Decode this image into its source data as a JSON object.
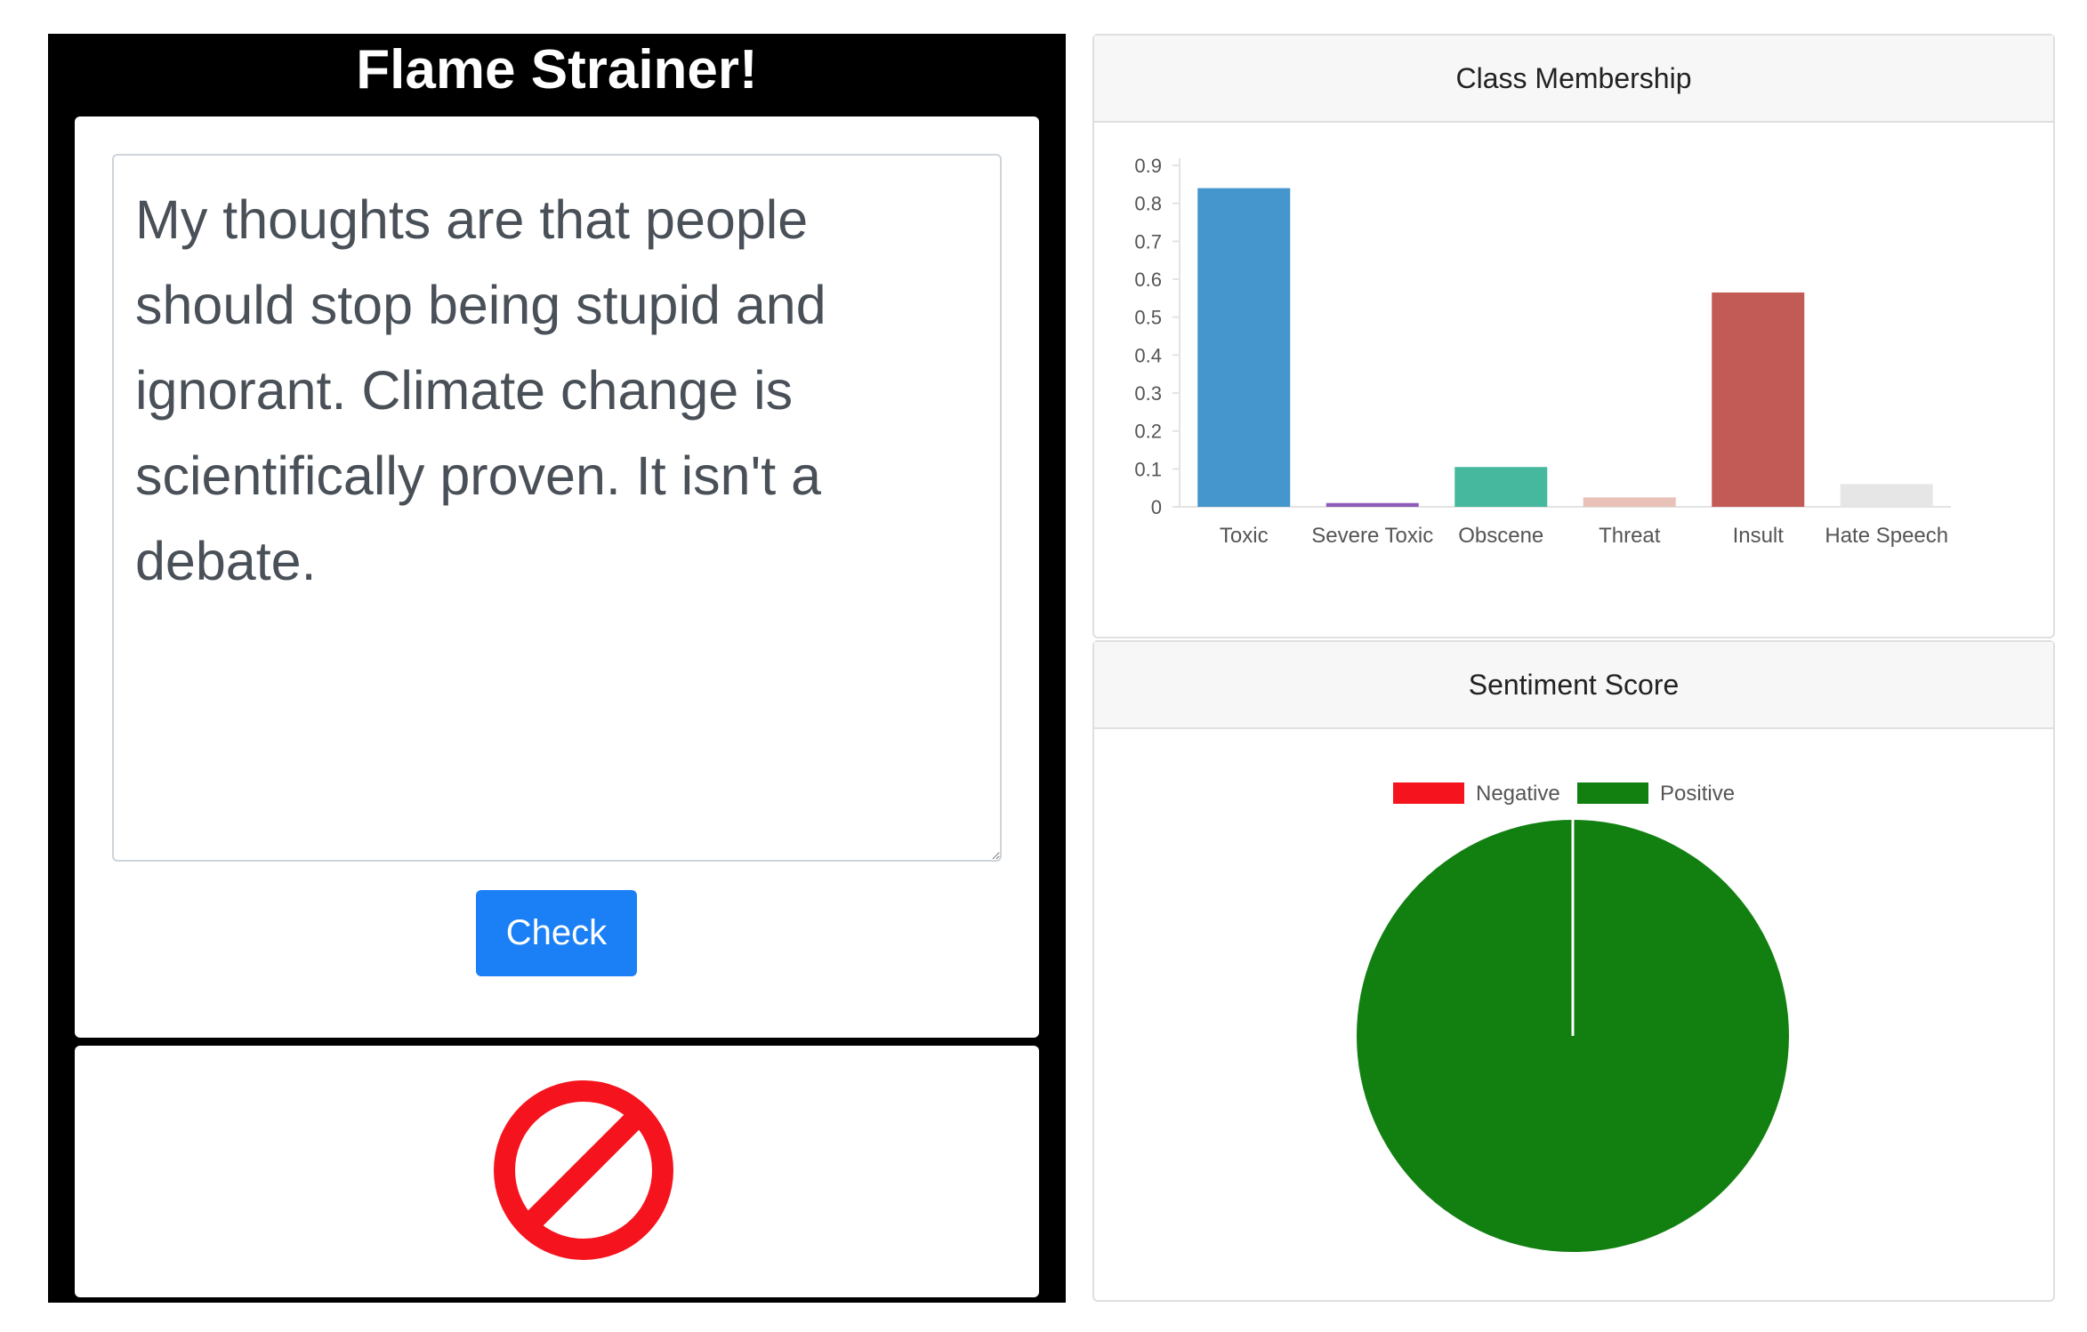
{
  "app": {
    "title": "Flame Strainer!"
  },
  "input": {
    "comment_text": "My thoughts are that people should stop being stupid and ignorant. Climate change is scientifically proven. It isn't a debate.",
    "check_label": "Check"
  },
  "result": {
    "icon": "prohibited-icon",
    "icon_color": "#f5141e"
  },
  "class_panel": {
    "title": "Class Membership"
  },
  "sentiment_panel": {
    "title": "Sentiment Score"
  },
  "chart_data": [
    {
      "type": "bar",
      "title": "Class Membership",
      "categories": [
        "Toxic",
        "Severe Toxic",
        "Obscene",
        "Threat",
        "Insult",
        "Hate Speech"
      ],
      "values": [
        0.84,
        0.01,
        0.105,
        0.025,
        0.565,
        0.06
      ],
      "colors": [
        "#4496cd",
        "#8e5bb8",
        "#45b89d",
        "#e8c2b8",
        "#c25b55",
        "#e6e6e6"
      ],
      "ylim": [
        0,
        0.9
      ],
      "yticks": [
        "0",
        "0.1",
        "0.2",
        "0.3",
        "0.4",
        "0.5",
        "0.6",
        "0.7",
        "0.8",
        "0.9"
      ],
      "legend": false,
      "grid": false
    },
    {
      "type": "pie",
      "title": "Sentiment Score",
      "labels": [
        "Negative",
        "Positive"
      ],
      "values": [
        0.0,
        1.0
      ],
      "colors": [
        "#f5141e",
        "#127f11"
      ],
      "legend": "top"
    }
  ]
}
